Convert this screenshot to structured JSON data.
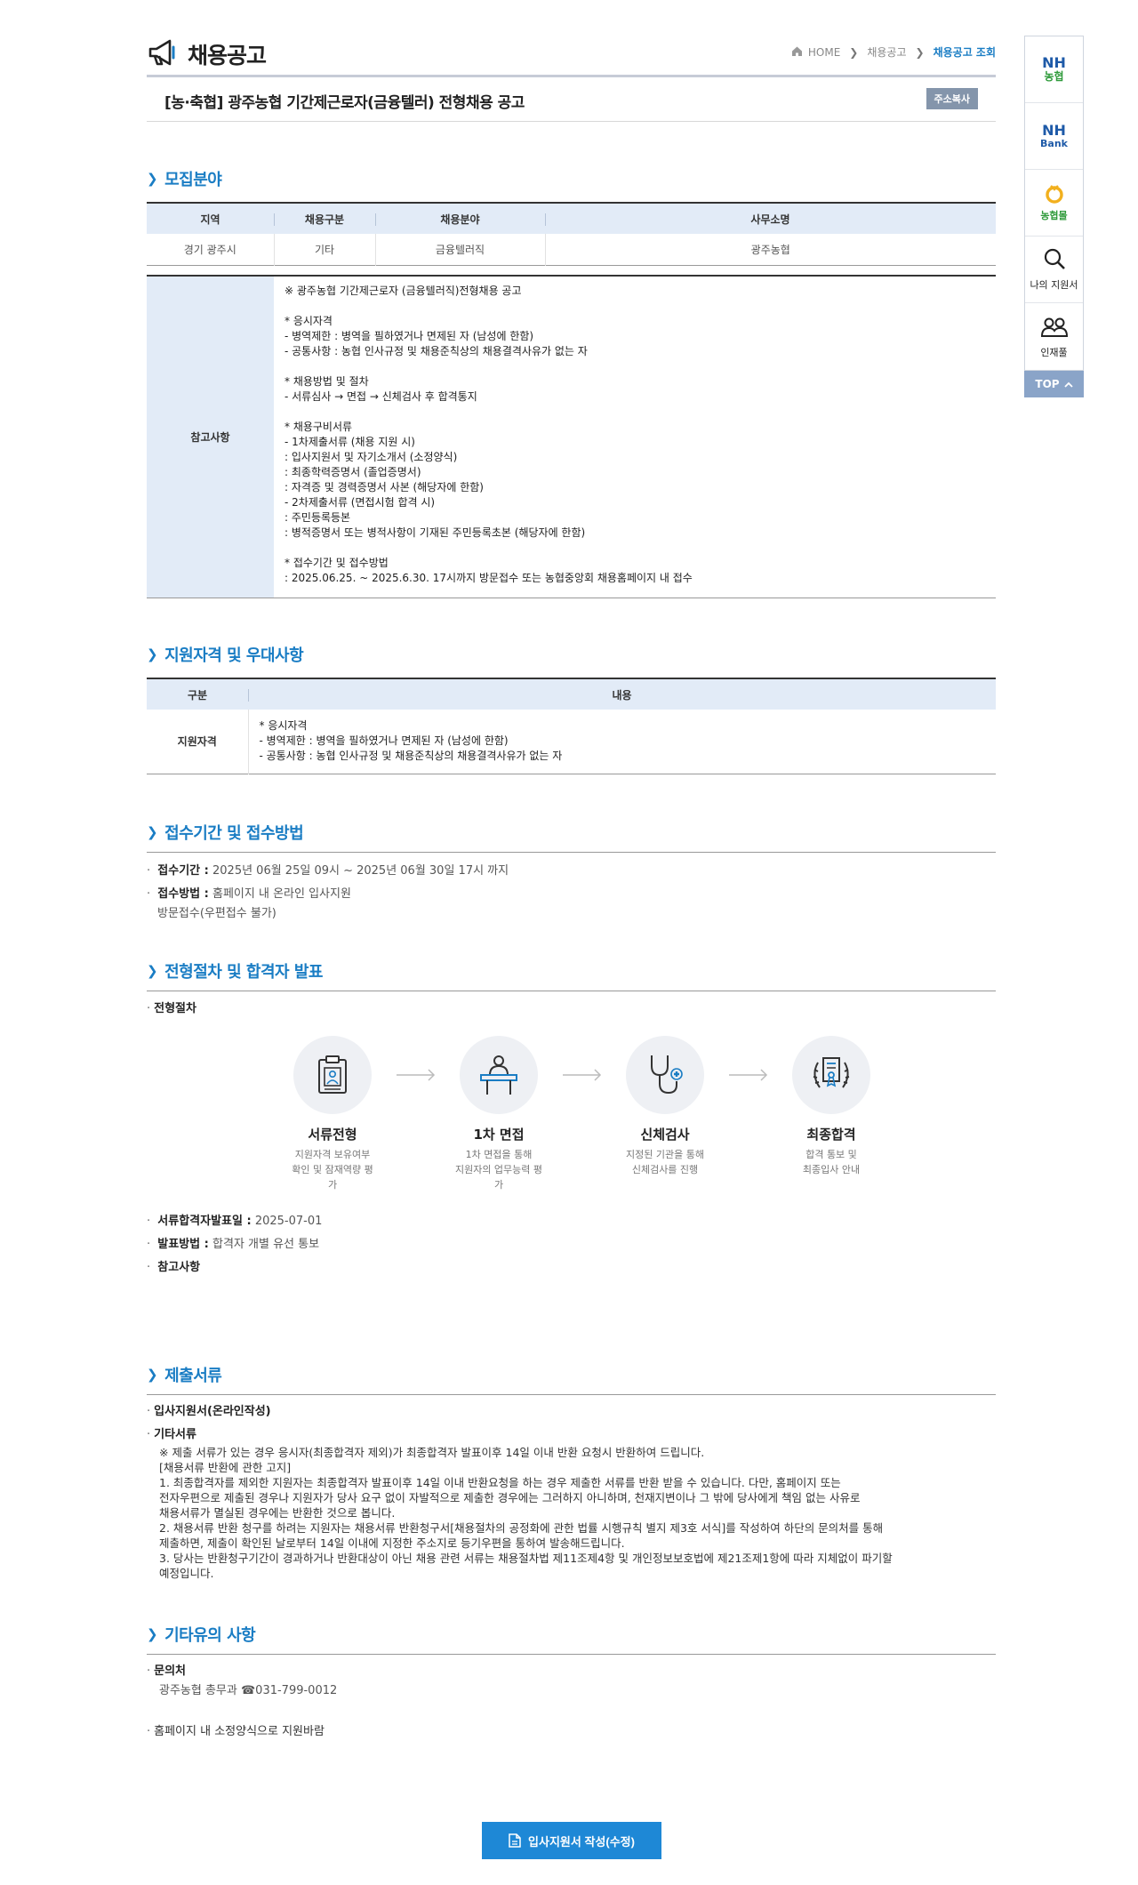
{
  "header": {
    "title": "채용공고",
    "breadcrumb": [
      "HOME",
      "채용공고",
      "채용공고 조회"
    ]
  },
  "job": {
    "title": "[농·축협] 광주농협 기간제근로자(금융텔러) 전형채용 공고",
    "copy_label": "주소복사"
  },
  "recruit": {
    "section_title": "모집분야",
    "columns": [
      "지역",
      "채용구분",
      "채용분야",
      "사무소명"
    ],
    "row": [
      "경기 광주시",
      "기타",
      "금융텔러직",
      "광주농협"
    ],
    "ref_label": "참고사항",
    "ref_text": "※ 광주농협 기간제근로자 (금융텔러직)전형채용 공고\n\n* 응시자격\n- 병역제한 : 병역을 필하였거나 면제된 자 (남성에 한함)\n- 공통사항 : 농협 인사규정 및 채용준칙상의 채용결격사유가 없는 자\n\n* 채용방법 및 절차\n- 서류심사 → 면접 → 신체검사 후 합격통지\n\n* 채용구비서류\n- 1차제출서류 (채용 지원 시)\n: 입사지원서 및 자기소개서 (소정양식)\n: 최종학력증명서 (졸업증명서)\n: 자격증 및 경력증명서 사본 (해당자에 한함)\n- 2차제출서류 (면접시험 합격 시)\n: 주민등록등본\n: 병적증명서 또는 병적사항이 기재된 주민등록초본 (해당자에 한함)\n\n* 접수기간 및 접수방법\n: 2025.06.25. ~ 2025.6.30. 17시까지 방문접수 또는 농협중앙회 채용홈페이지 내 접수"
  },
  "qualification": {
    "section_title": "지원자격 및 우대사항",
    "columns": [
      "구분",
      "내용"
    ],
    "row_label": "지원자격",
    "row_text": "* 응시자격\n- 병역제한 : 병역을 필하였거나 면제된 자 (남성에 한함)\n- 공통사항 : 농협 인사규정 및 채용준칙상의 채용결격사유가 없는 자"
  },
  "period": {
    "section_title": "접수기간 및 접수방법",
    "period_label": "접수기간 :",
    "period_value": "2025년 06월 25일 09시 ~ 2025년 06월 30일 17시 까지",
    "method_label": "접수방법 :",
    "method_value": "홈페이지 내 온라인 입사지원",
    "method_value2": "방문접수(우편접수 불가)"
  },
  "process": {
    "section_title": "전형절차 및 합격자 발표",
    "sub_label": "전형절차",
    "steps": [
      {
        "title": "서류전형",
        "desc": "지원자격 보유여부\n확인 및 잠재역량 평가"
      },
      {
        "title": "1차 면접",
        "desc": "1차 면접을 통해\n지원자의 업무능력 평가"
      },
      {
        "title": "신체검사",
        "desc": "지정된 기관을 통해\n신체검사를 진행"
      },
      {
        "title": "최종합격",
        "desc": "합격 통보 및\n최종입사 안내"
      }
    ],
    "doc_date_label": "서류합격자발표일 :",
    "doc_date_value": "2025-07-01",
    "announce_label": "발표방법 :",
    "announce_value": "합격자 개별 유선 통보",
    "note_label": "참고사항"
  },
  "documents": {
    "section_title": "제출서류",
    "item1": "입사지원서(온라인작성)",
    "item2": "기타서류",
    "text": "※ 제출 서류가 있는 경우 응시자(최종합격자 제외)가 최종합격자 발표이후 14일 이내 반환 요청시 반환하여 드립니다.\n[채용서류 반환에 관한 고지]\n  1. 최종합격자를 제외한 지원자는 최종합격자 발표이후 14일 이내 반환요청을 하는 경우 제출한 서류를 반환 받을 수 있습니다. 다만, 홈페이지 또는\n전자우편으로 제출된 경우나 지원자가 당사 요구 없이 자발적으로 제출한 경우에는 그러하지 아니하며, 천재지변이나 그 밖에 당사에게 책임 없는 사유로\n채용서류가 멸실된 경우에는 반환한 것으로 봅니다.\n  2. 채용서류 반환 청구를 하려는 지원자는 채용서류 반환청구서[채용절차의 공정화에 관한 법률 시행규칙 별지 제3호 서식]를 작성하여 하단의 문의처를 통해\n제출하면, 제출이 확인된 날로부터 14일 이내에 지정한 주소지로 등기우편을 통하여 발송해드립니다.\n  3. 당사는 반환청구기간이 경과하거나 반환대상이 아닌 채용 관련 서류는 채용절차법 제11조제4항 및 개인정보보호법에 제21조제1항에 따라 지체없이 파기할\n예정입니다."
  },
  "etc": {
    "section_title": "기타유의 사항",
    "contact_label": "문의처",
    "contact_value": "광주농협 총무과 ☎031-799-0012",
    "note": "홈페이지 내 소정양식으로 지원바람"
  },
  "apply_button": "입사지원서 작성(수정)",
  "quick_menu": {
    "nh_nonghyup_top": "NH",
    "nh_nonghyup_bottom": "농협",
    "nh_bank_top": "NH",
    "nh_bank_bottom": "Bank",
    "nonghyup_mall": "농협몰",
    "my_application": "나의 지원서",
    "talent_pool": "인재풀",
    "top": "TOP"
  },
  "colors": {
    "accent": "#1a7dc4",
    "table_head": "#e2ebf7",
    "button": "#1e88d6",
    "quick_top": "#8aa4c8"
  }
}
